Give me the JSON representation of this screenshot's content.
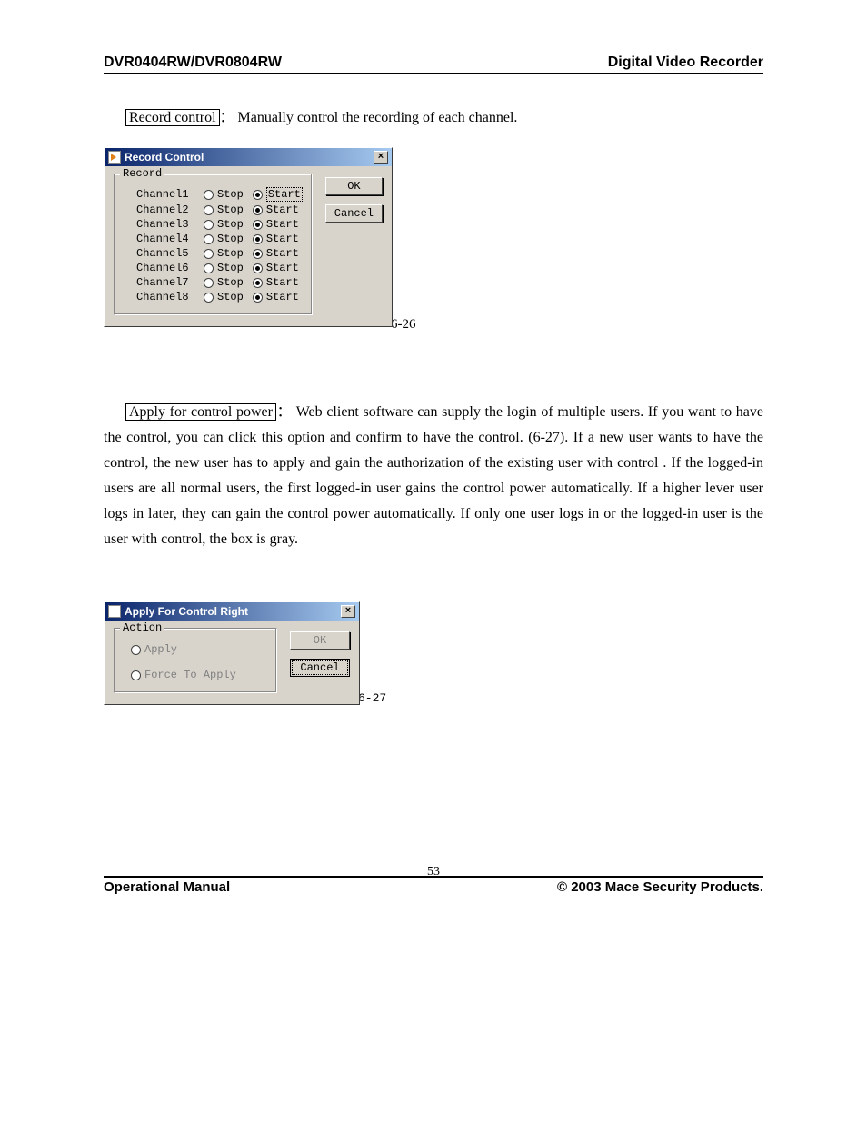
{
  "header": {
    "left": "DVR0404RW/DVR0804RW",
    "right": "Digital Video Recorder"
  },
  "section1": {
    "boxed_label": "Record control",
    "colon": "：",
    "description": "Manually control the recording of each channel."
  },
  "dialog1": {
    "title": "Record Control",
    "close": "×",
    "group_legend": "Record",
    "channels": [
      {
        "name": "Channel1",
        "stop": "Stop",
        "start": "Start",
        "selected": "start"
      },
      {
        "name": "Channel2",
        "stop": "Stop",
        "start": "Start",
        "selected": "start"
      },
      {
        "name": "Channel3",
        "stop": "Stop",
        "start": "Start",
        "selected": "start"
      },
      {
        "name": "Channel4",
        "stop": "Stop",
        "start": "Start",
        "selected": "start"
      },
      {
        "name": "Channel5",
        "stop": "Stop",
        "start": "Start",
        "selected": "start"
      },
      {
        "name": "Channel6",
        "stop": "Stop",
        "start": "Start",
        "selected": "start"
      },
      {
        "name": "Channel7",
        "stop": "Stop",
        "start": "Start",
        "selected": "start"
      },
      {
        "name": "Channel8",
        "stop": "Stop",
        "start": "Start",
        "selected": "start"
      }
    ],
    "ok_label": "OK",
    "cancel_label": "Cancel",
    "figure_number": "6-26"
  },
  "section2": {
    "boxed_label": "Apply for control power",
    "colon": "：",
    "description": "Web client software can supply the login of multiple users. If you want to have the control, you can click this option and confirm to have the control. (6-27). If a new user wants to have the control, the new user has to apply and gain the authorization of the existing user with control . If the logged-in users are all normal users, the first logged-in user gains the control power automatically. If a higher lever user logs in later, they can gain the control power automatically. If only one user logs in or the logged-in user is the user with control, the box is gray."
  },
  "dialog2": {
    "title": "Apply For Control Right",
    "close": "×",
    "group_legend": "Action",
    "option1": "Apply",
    "option2": "Force To Apply",
    "ok_label": "OK",
    "cancel_label": "Cancel",
    "figure_number": "6-27"
  },
  "footer": {
    "left": "Operational Manual",
    "center": "53",
    "right": "© 2003 Mace Security Products."
  }
}
